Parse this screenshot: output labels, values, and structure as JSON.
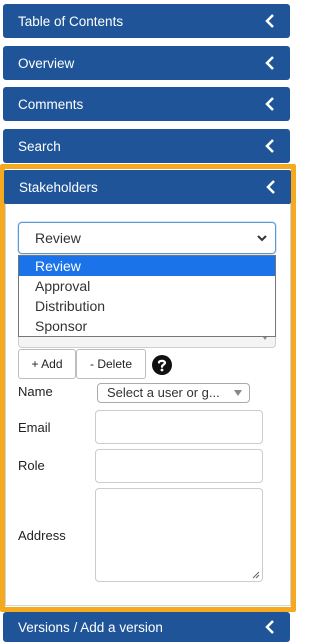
{
  "panels": {
    "toc": "Table of Contents",
    "overview": "Overview",
    "comments": "Comments",
    "search": "Search",
    "stakeholders": "Stakeholders",
    "versions": "Versions / Add a version"
  },
  "stakeholders": {
    "select_value": "Review",
    "options": [
      "Review",
      "Approval",
      "Distribution",
      "Sponsor"
    ],
    "add_label": "+ Add",
    "delete_label": "- Delete",
    "name_label": "Name",
    "user_placeholder": "Select a user or g...",
    "email_label": "Email",
    "role_label": "Role",
    "address_label": "Address"
  },
  "colors": {
    "header_bg": "#1f5598",
    "highlight_border": "#f5a91e",
    "selected_option": "#1a73e8"
  },
  "icons": {
    "chevron": "chevron-left-icon",
    "help": "question-circle-icon",
    "dropdown": "chevron-down-icon"
  }
}
